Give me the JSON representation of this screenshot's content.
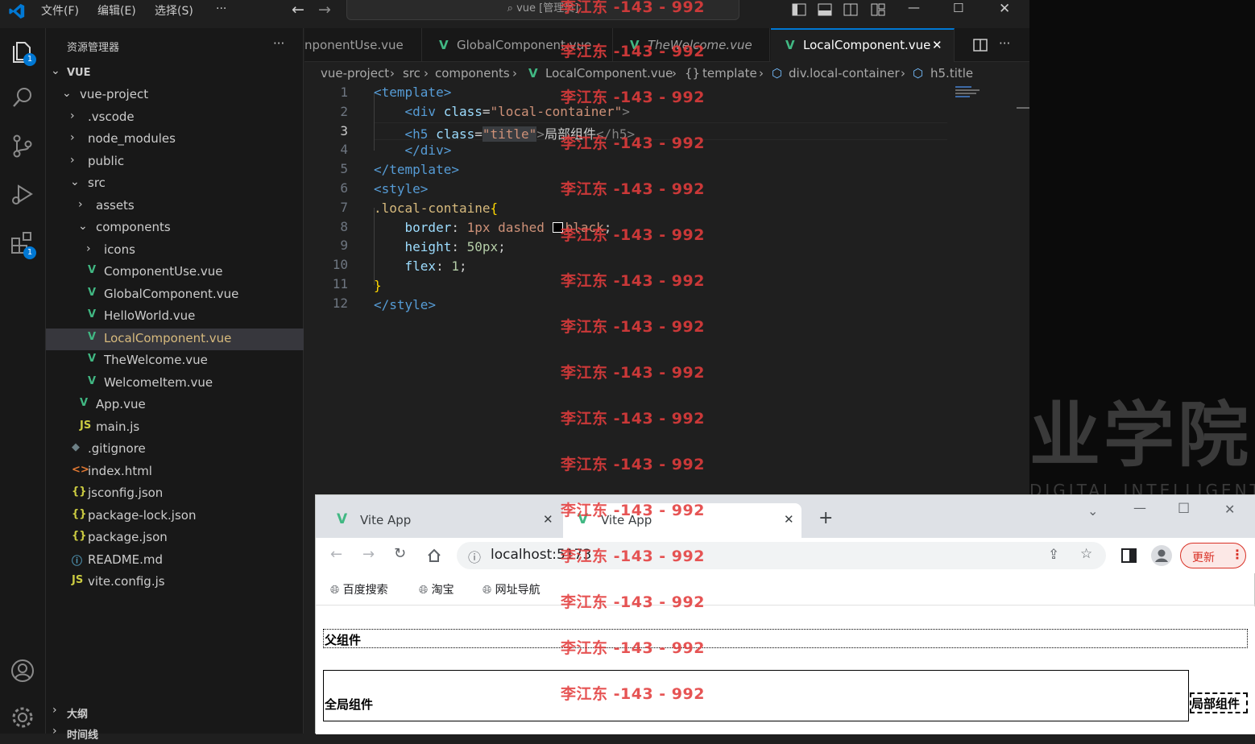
{
  "titlebar": {
    "menu": [
      "文件(F)",
      "编辑(E)",
      "选择(S)",
      "···"
    ],
    "search": "vue [管理员]"
  },
  "activity": {
    "explorer_badge": "1",
    "extensions_badge": "1"
  },
  "sidebar": {
    "title": "资源管理器",
    "more": "···",
    "root": "VUE",
    "items": [
      {
        "label": "vue-project",
        "icon": "",
        "chev": "⌄"
      },
      {
        "label": ".vscode",
        "icon": "",
        "chev": "›"
      },
      {
        "label": "node_modules",
        "icon": "",
        "chev": "›"
      },
      {
        "label": "public",
        "icon": "",
        "chev": "›"
      },
      {
        "label": "src",
        "icon": "",
        "chev": "⌄"
      },
      {
        "label": "assets",
        "icon": "",
        "chev": "›"
      },
      {
        "label": "components",
        "icon": "",
        "chev": "⌄"
      },
      {
        "label": "icons",
        "icon": "",
        "chev": "›"
      },
      {
        "label": "ComponentUse.vue",
        "icon": "V",
        "chev": ""
      },
      {
        "label": "GlobalComponent.vue",
        "icon": "V",
        "chev": ""
      },
      {
        "label": "HelloWorld.vue",
        "icon": "V",
        "chev": ""
      },
      {
        "label": "LocalComponent.vue",
        "icon": "V",
        "chev": ""
      },
      {
        "label": "TheWelcome.vue",
        "icon": "V",
        "chev": ""
      },
      {
        "label": "WelcomeItem.vue",
        "icon": "V",
        "chev": ""
      },
      {
        "label": "App.vue",
        "icon": "V",
        "chev": ""
      },
      {
        "label": "main.js",
        "icon": "JS",
        "chev": ""
      },
      {
        "label": ".gitignore",
        "icon": "◆",
        "chev": ""
      },
      {
        "label": "index.html",
        "icon": "<>",
        "chev": ""
      },
      {
        "label": "jsconfig.json",
        "icon": "{}",
        "chev": ""
      },
      {
        "label": "package-lock.json",
        "icon": "{}",
        "chev": ""
      },
      {
        "label": "package.json",
        "icon": "{}",
        "chev": ""
      },
      {
        "label": "README.md",
        "icon": "ⓘ",
        "chev": ""
      },
      {
        "label": "vite.config.js",
        "icon": "JS",
        "chev": ""
      }
    ],
    "outline": "大纲",
    "timeline": "时间线"
  },
  "tabs": [
    {
      "label": "nponentUse.vue",
      "active": false,
      "italic": false
    },
    {
      "label": "GlobalComponent.vue",
      "active": false,
      "italic": false
    },
    {
      "label": "TheWelcome.vue",
      "active": false,
      "italic": true
    },
    {
      "label": "LocalComponent.vue",
      "active": true,
      "italic": false
    }
  ],
  "tab_close": "✕",
  "breadcrumb": [
    "vue-project",
    "src",
    "components",
    "LocalComponent.vue",
    "template",
    "div.local-container",
    "h5.title"
  ],
  "editor": {
    "line_numbers": [
      "1",
      "2",
      "3",
      "4",
      "5",
      "6",
      "7",
      "8",
      "9",
      "10",
      "11",
      "12"
    ],
    "current_line": "3",
    "code": {
      "l1_tag": "<template>",
      "l2_open": "<div ",
      "l2_attr": "class",
      "l2_eq": "=",
      "l2_val": "\"local-container\"",
      "l2_close": ">",
      "l3_open": "<h5 ",
      "l3_attr": "class",
      "l3_eq": "=",
      "l3_val": "\"title\"",
      "l3_gt": ">",
      "l3_text": "局部组件",
      "l3_close": "</h5>",
      "l4": "</div>",
      "l5": "</template>",
      "l6": "<style>",
      "l7_sel": ".local-containe",
      "l7_brace": "{",
      "l8_prop": "border",
      "l8_val": "1px dashed ",
      "l8_color": "black",
      "l9_prop": "height",
      "l9_val": "50px",
      "l10_prop": "flex",
      "l10_val": "1",
      "l11": "}",
      "l12": "</style>"
    }
  },
  "browser": {
    "tabs": [
      "Vite App",
      "Vite App"
    ],
    "new_tab": "+",
    "url": "localhost:5173",
    "update_label": "更新",
    "bookmarks": [
      "百度搜索",
      "淘宝",
      "网址导航"
    ],
    "page": {
      "parent": "父组件",
      "global": "全局组件",
      "local": "局部组件"
    }
  },
  "desktop": {
    "big_text": "业学院",
    "small_text": "DIGITAL INTELLIGENT"
  },
  "watermark": "李江东 -143 - 992",
  "colors": {
    "vscode_bg": "#1f1f1f",
    "accent": "#0078d4",
    "vue_green": "#41b883",
    "watermark": "#e23c3c"
  }
}
